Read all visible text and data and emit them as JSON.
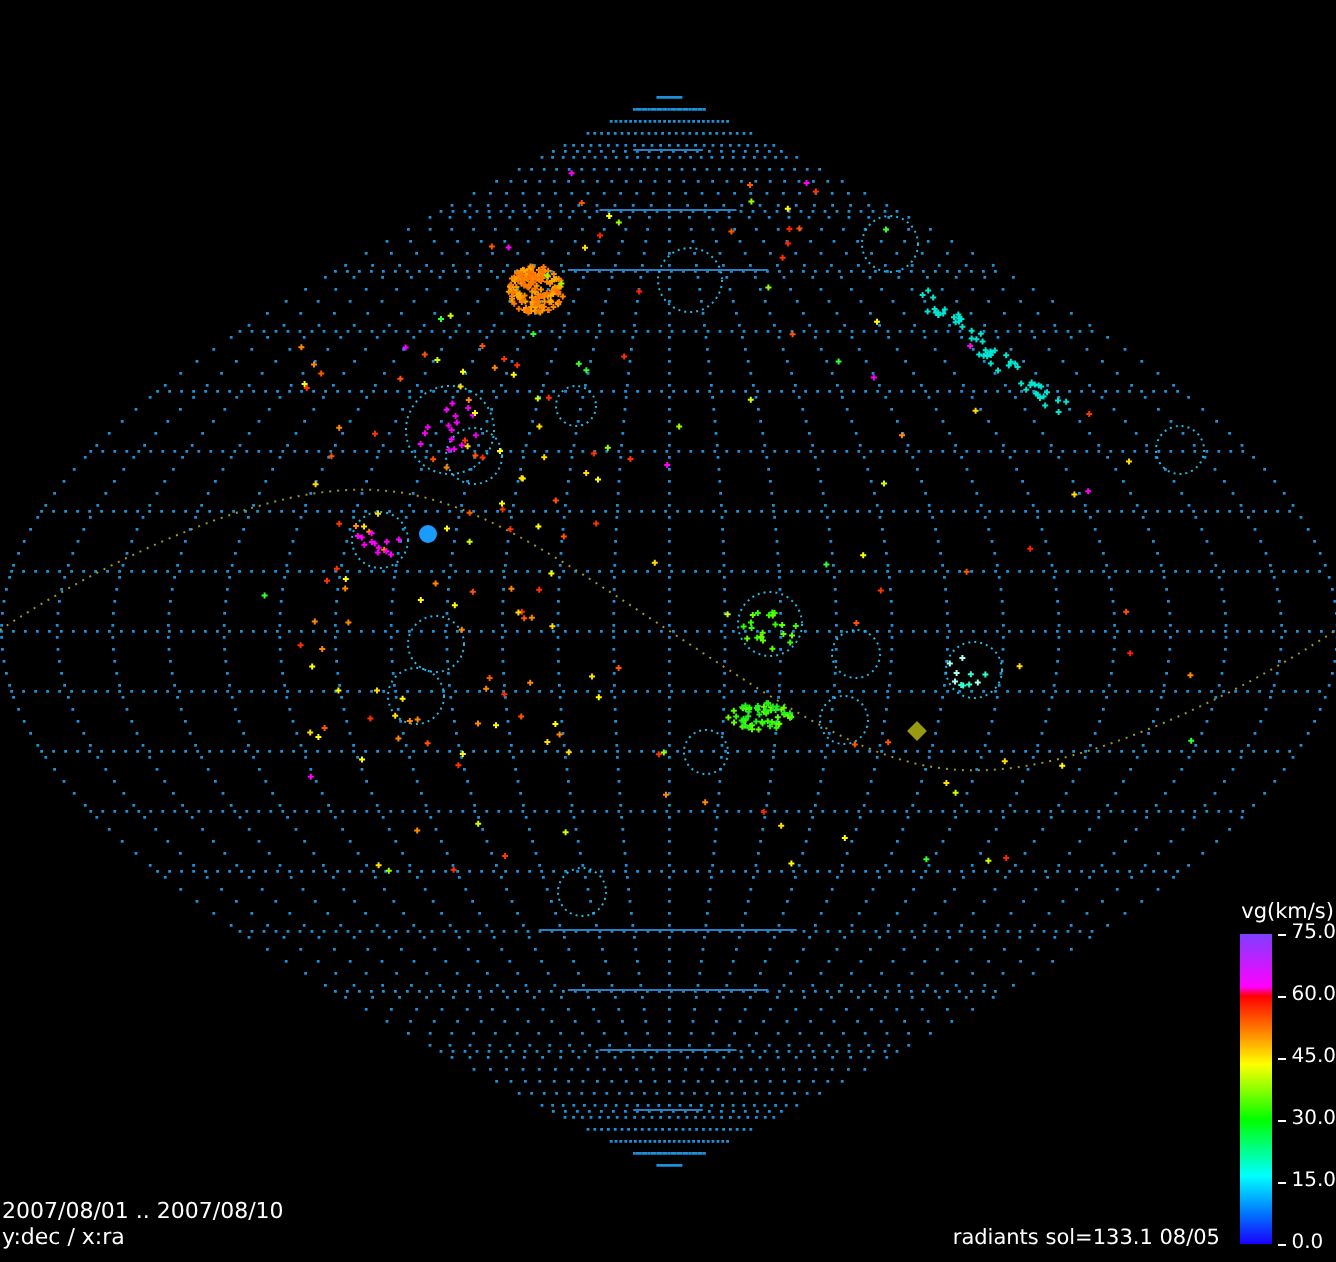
{
  "date_range": "2007/08/01 .. 2007/08/10",
  "axes_label": "y:dec / x:ra",
  "status": "radiants sol=133.1 08/05",
  "colorbar": {
    "title": "vg(km/s)",
    "ticks": [
      "75.0",
      "60.0",
      "45.0",
      "30.0",
      "15.0",
      "0.0"
    ]
  }
}
